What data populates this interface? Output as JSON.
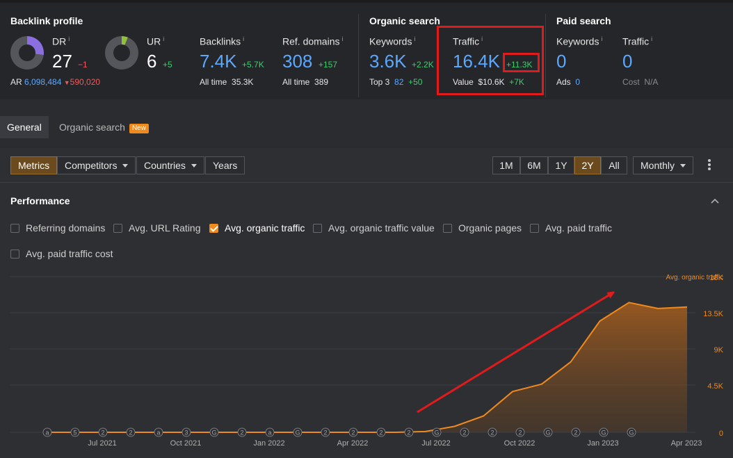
{
  "backlink_profile": {
    "title": "Backlink profile",
    "dr": {
      "label": "DR",
      "value": "27",
      "delta": "−1",
      "fill": 0.27
    },
    "ur": {
      "label": "UR",
      "value": "6",
      "delta": "+5",
      "fill": 0.06
    },
    "ar": {
      "label": "AR",
      "value": "6,098,484",
      "delta": "590,020"
    },
    "backlinks": {
      "label": "Backlinks",
      "value": "7.4K",
      "delta": "+5.7K",
      "sub_label": "All time",
      "sub_value": "35.3K"
    },
    "ref_domains": {
      "label": "Ref. domains",
      "value": "308",
      "delta": "+157",
      "sub_label": "All time",
      "sub_value": "389"
    }
  },
  "organic_search": {
    "title": "Organic search",
    "keywords": {
      "label": "Keywords",
      "value": "3.6K",
      "delta": "+2.2K",
      "sub_label": "Top 3",
      "sub_value": "82",
      "sub_delta": "+50"
    },
    "traffic": {
      "label": "Traffic",
      "value": "16.4K",
      "delta": "+11.3K",
      "sub_label": "Value",
      "sub_value": "$10.6K",
      "sub_delta": "+7K"
    }
  },
  "paid_search": {
    "title": "Paid search",
    "keywords": {
      "label": "Keywords",
      "value": "0",
      "sub_label": "Ads",
      "sub_value": "0"
    },
    "traffic": {
      "label": "Traffic",
      "value": "0",
      "sub_label": "Cost",
      "sub_value": "N/A"
    }
  },
  "info_mark": "i",
  "tabs": [
    {
      "label": "General",
      "active": true
    },
    {
      "label": "Organic search",
      "active": false,
      "badge": "New"
    }
  ],
  "controls": {
    "views": [
      "Metrics",
      "Competitors",
      "Countries",
      "Years"
    ],
    "ranges": [
      "1M",
      "6M",
      "1Y",
      "2Y",
      "All"
    ],
    "selected_range": "2Y",
    "granularity": "Monthly"
  },
  "performance": {
    "title": "Performance",
    "checkboxes": [
      {
        "label": "Referring domains",
        "checked": false
      },
      {
        "label": "Avg. URL Rating",
        "checked": false
      },
      {
        "label": "Avg. organic traffic",
        "checked": true
      },
      {
        "label": "Avg. organic traffic value",
        "checked": false
      },
      {
        "label": "Organic pages",
        "checked": false
      },
      {
        "label": "Avg. paid traffic",
        "checked": false
      },
      {
        "label": "Avg. paid traffic cost",
        "checked": false
      }
    ]
  },
  "colors": {
    "accent": "#f08a1c",
    "blue": "#5ba8ff",
    "positive": "#3ecf6c",
    "negative": "#f05a5a",
    "highlight": "#e11b1b"
  },
  "chart_data": {
    "type": "area",
    "series": [
      {
        "name": "Avg. organic traffic",
        "x": [
          "2021-06",
          "2021-07",
          "2021-08",
          "2021-09",
          "2021-10",
          "2021-11",
          "2021-12",
          "2022-01",
          "2022-02",
          "2022-03",
          "2022-04",
          "2022-05",
          "2022-06",
          "2022-07",
          "2022-08",
          "2022-09",
          "2022-10",
          "2022-11",
          "2022-12",
          "2023-01",
          "2023-02",
          "2023-03",
          "2023-04"
        ],
        "values": [
          0,
          0,
          0,
          0,
          0,
          0,
          0,
          0,
          0,
          0,
          0,
          0,
          0,
          100,
          800,
          2200,
          5500,
          6500,
          9500,
          15000,
          17500,
          16700,
          16900
        ]
      }
    ],
    "y_ticks": [
      "18K",
      "13.5K",
      "9K",
      "4.5K",
      "0"
    ],
    "x_ticks": [
      "Jul 2021",
      "Oct 2021",
      "Jan 2022",
      "Apr 2022",
      "Jul 2022",
      "Oct 2022",
      "Jan 2023",
      "Apr 2023"
    ],
    "ylim": [
      0,
      18000
    ],
    "grid": true,
    "legend": "top-right",
    "markers": [
      "a",
      "5",
      "2",
      "2",
      "a",
      "3",
      "G",
      "2",
      "a",
      "G",
      "2",
      "2",
      "2",
      "2",
      "G",
      "2",
      "2",
      "2",
      "G",
      "2",
      "G",
      "G"
    ],
    "annotation": "red arrow pointing up along the traffic growth"
  }
}
